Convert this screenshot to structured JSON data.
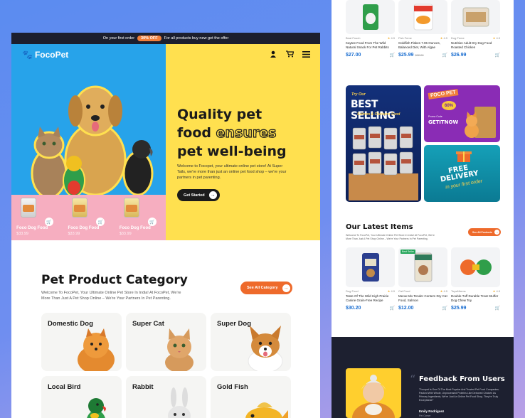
{
  "promo_bar": {
    "prefix": "On your first order",
    "badge": "30% OFF",
    "suffix": "For all products buy new get the offer"
  },
  "brand": {
    "name": "FocoPet"
  },
  "hero": {
    "title_line1": "Quality pet",
    "title_line2_a": "food",
    "title_line2_b": "ensures",
    "title_line3": "pet well-being",
    "description": "Welcome to Focopet, your ultimate online pet store! At Super Tails, we're more than just an online pet food shop – we're your partners in pet parenting.",
    "cta_label": "Get Started",
    "mini_products": [
      {
        "name": "Foco Dog Food",
        "price": "$33.99"
      },
      {
        "name": "Foco Dog Food",
        "price": "$33.99"
      },
      {
        "name": "Foco Dog Food",
        "price": "$33.99"
      }
    ]
  },
  "category": {
    "title": "Pet Product Category",
    "description": "Welcome To FocoPet, Your Ultimate Online Pet Store In India! At FocoPet, We're More Than Just A Pet Shop Online – We're Your Partners In Pet Parenting.",
    "button_label": "See All Category",
    "items": [
      {
        "name": "Domestic Dog"
      },
      {
        "name": "Super Cat"
      },
      {
        "name": "Super Dog"
      },
      {
        "name": "Local Bird"
      },
      {
        "name": "Rabbit"
      },
      {
        "name": "Gold Fish"
      }
    ]
  },
  "top_products": [
    {
      "brand": "Beat Fouch",
      "rating": "4.9",
      "name": "Kaytee Food From The Wild Natural Snack For Pet Rabbits",
      "price": "$27.00",
      "old_price": ""
    },
    {
      "brand": "Fish Feme",
      "rating": "4.9",
      "name": "Goldfish Flakes 7.06 Ounces, Balanced Diet, With Algae",
      "price": "$25.99",
      "old_price": "$32.00"
    },
    {
      "brand": "Dog Feme",
      "rating": "4.9",
      "name": "Nutrition Adult Dry Dog Food Roasted Chicken",
      "price": "$26.99",
      "old_price": ""
    }
  ],
  "banners": {
    "big": {
      "try": "Try Our",
      "headline": "BEST SELLING",
      "sub": "Salmon & Chickens Food"
    },
    "promo": {
      "foco": "FOCO PET",
      "percent": "60%",
      "promo_code_label": "Promo Code",
      "code": "GETITNOW"
    },
    "delivery": {
      "line1": "FREE",
      "line2": "DELIVERY",
      "line3": "in your first order"
    }
  },
  "latest": {
    "title": "Our Latest Items",
    "description": "Welcome To FocoPet, Your Ultimate Online Pet Store In India! At FocoPet, We're More Than Just A Pet Shop Online – We're Your Partners In Pet Parenting.",
    "button_label": "See All Products",
    "items": [
      {
        "brand": "Dog Food",
        "rating": "4.9",
        "tag": "",
        "name": "Taste Of The Wild High Prairie Canine Grain-Free Recipe",
        "price": "$30.20"
      },
      {
        "brand": "Cat Food",
        "rating": "4.9",
        "tag": "Best Seller",
        "name": "Meow Mix Tender Centers Dry Cat Food, Salmon",
        "price": "$12.00"
      },
      {
        "brand": "Toys&Items",
        "rating": "4.9",
        "tag": "",
        "name": "Double-Tuff Durable Treat Stuffer Dog Chew Toy",
        "price": "$25.99"
      }
    ]
  },
  "feedback": {
    "title": "Feedback From Users",
    "text": "\"Focopet Is One Of The Most Popular And Trusted Pet Food Companies. Packed With Whole, Unprocessed Proteins Like Deboned Chicken As Primary Ingredients, We're Just An Online Pet Food Shop, They're Truly Exceptional!\"",
    "user": "Emily Rodriguez",
    "role": "Pet Owner"
  },
  "colors": {
    "hero_blue": "#27a3ea",
    "hero_yellow": "#ffe04f",
    "hero_pink": "#f6aec0",
    "accent_orange": "#ee6a2b",
    "price_blue": "#1c6fd1",
    "dark": "#1d2030"
  }
}
